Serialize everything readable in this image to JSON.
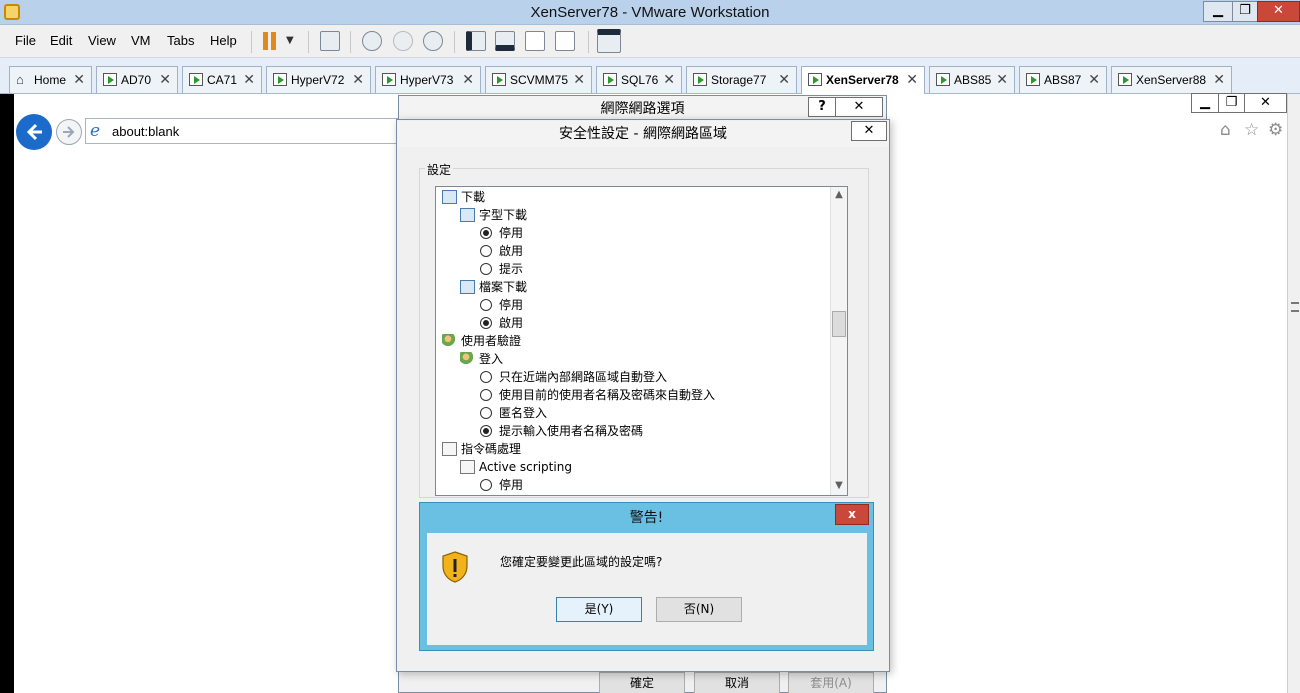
{
  "window": {
    "title": "XenServer78 - VMware Workstation",
    "min": "▁",
    "restore": "❐",
    "close": "✕"
  },
  "menu": [
    "File",
    "Edit",
    "View",
    "VM",
    "Tabs",
    "Help"
  ],
  "tabs": [
    {
      "label": "Home"
    },
    {
      "label": "AD70"
    },
    {
      "label": "CA71"
    },
    {
      "label": "HyperV72"
    },
    {
      "label": "HyperV73"
    },
    {
      "label": "SCVMM75"
    },
    {
      "label": "SQL76"
    },
    {
      "label": "Storage77"
    },
    {
      "label": "XenServer78"
    },
    {
      "label": "ABS85"
    },
    {
      "label": "ABS87"
    },
    {
      "label": "XenServer88"
    }
  ],
  "browser": {
    "url": "about:blank"
  },
  "internet_options": {
    "title": "網際網路選項",
    "help": "?",
    "close": "✕",
    "ok": "確定",
    "cancel": "取消",
    "apply": "套用(A)"
  },
  "security": {
    "title": "安全性設定 - 網際網路區域",
    "close": "✕",
    "settings_label": "設定",
    "tree": [
      {
        "kind": "folder",
        "level": 0,
        "label": "下載"
      },
      {
        "kind": "folder",
        "level": 1,
        "label": "字型下載"
      },
      {
        "kind": "radio",
        "level": 2,
        "label": "停用",
        "checked": true
      },
      {
        "kind": "radio",
        "level": 2,
        "label": "啟用",
        "checked": false
      },
      {
        "kind": "radio",
        "level": 2,
        "label": "提示",
        "checked": false
      },
      {
        "kind": "folder",
        "level": 1,
        "label": "檔案下載"
      },
      {
        "kind": "radio",
        "level": 2,
        "label": "停用",
        "checked": false
      },
      {
        "kind": "radio",
        "level": 2,
        "label": "啟用",
        "checked": true
      },
      {
        "kind": "user",
        "level": 0,
        "label": "使用者驗證"
      },
      {
        "kind": "user",
        "level": 1,
        "label": "登入"
      },
      {
        "kind": "radio",
        "level": 2,
        "label": "只在近端內部網路區域自動登入",
        "checked": false
      },
      {
        "kind": "radio",
        "level": 2,
        "label": "使用目前的使用者名稱及密碼來自動登入",
        "checked": false
      },
      {
        "kind": "radio",
        "level": 2,
        "label": "匿名登入",
        "checked": false
      },
      {
        "kind": "radio",
        "level": 2,
        "label": "提示輸入使用者名稱及密碼",
        "checked": true
      },
      {
        "kind": "script",
        "level": 0,
        "label": "指令碼處理"
      },
      {
        "kind": "script",
        "level": 1,
        "label": "Active scripting"
      },
      {
        "kind": "radio",
        "level": 2,
        "label": "停用",
        "checked": false
      }
    ]
  },
  "warning": {
    "title": "警告!",
    "close": "x",
    "message": "您確定要變更此區域的設定嗎?",
    "yes": "是(Y)",
    "no": "否(N)"
  },
  "guest_window": {
    "min": "▁",
    "restore": "❐",
    "close": "✕"
  }
}
